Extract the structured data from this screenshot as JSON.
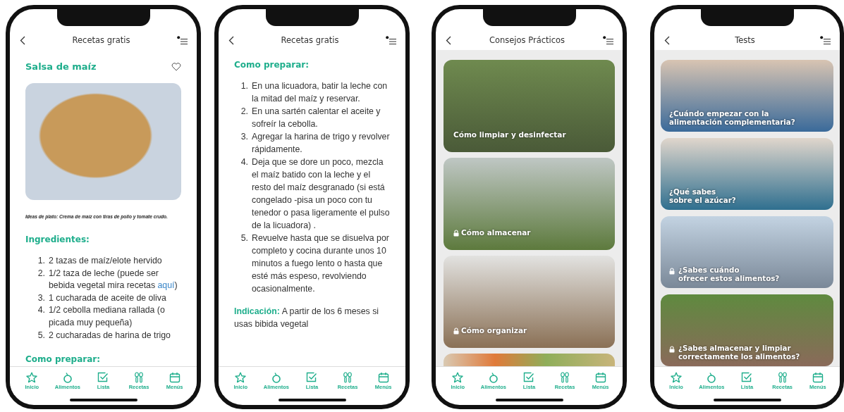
{
  "phones": [
    {
      "kind": "recipe",
      "header": {
        "title": "Recetas gratis"
      },
      "recipe_title": "Salsa de maíz",
      "caption": "Ideas de plato: Crema de maíz con tiras de pollo y tomate crudo.",
      "heading": "Ingredientes:",
      "items": [
        {
          "number": "1.",
          "text": "2 tazas de maíz/elote hervido"
        },
        {
          "number": "2.",
          "text": "1/2 taza de leche (puede ser bebida vegetal mira recetas ",
          "link": "aquí",
          "after": ")"
        },
        {
          "number": "3.",
          "text": "1 cucharada de aceite de oliva"
        },
        {
          "number": "4.",
          "text": "1/2 cebolla mediana rallada (o picada muy pequeña)"
        },
        {
          "number": "5.",
          "text": "2 cucharadas de harina de trigo"
        }
      ],
      "next_heading": "Como preparar:",
      "nav": [
        {
          "label": "Inicio",
          "kind": "star"
        },
        {
          "label": "Alimentos",
          "kind": "fruit"
        },
        {
          "label": "Lista",
          "kind": "check"
        },
        {
          "label": "Recetas",
          "kind": "utensils"
        },
        {
          "label": "Menús",
          "kind": "calendar"
        }
      ]
    },
    {
      "kind": "steps",
      "header": {
        "title": "Recetas gratis"
      },
      "heading": "Como preparar:",
      "items": [
        {
          "number": "1.",
          "text": "En una licuadora, batir la leche con la mitad del maíz y reservar."
        },
        {
          "number": "2.",
          "text": "En una sartén calentar el aceite y sofreír la cebolla."
        },
        {
          "number": "3.",
          "text": "Agregar la harina de trigo y revolver rápidamente."
        },
        {
          "number": "4.",
          "text": "Deja que se dore un poco, mezcla el maíz batido con la leche y el resto del maíz desgranado (si está congelado -pisa un poco con tu tenedor o pasa ligeramente el pulso de la licuadora) ."
        },
        {
          "number": "5.",
          "text": "Revuelve hasta que se disuelva por completo y cocina durante unos 10 minutos a fuego lento o hasta que esté más espeso, revolviendo ocasionalmente."
        }
      ],
      "note": "**Indicación:** A partir de los 6 meses si usas bibida vegetal",
      "nav": [
        {
          "label": "Inicio",
          "kind": "star"
        },
        {
          "label": "Alimentos",
          "kind": "fruit"
        },
        {
          "label": "Lista",
          "kind": "check"
        },
        {
          "label": "Recetas",
          "kind": "utensils"
        },
        {
          "label": "Menús",
          "kind": "calendar"
        }
      ]
    },
    {
      "kind": "tips",
      "header": {
        "title": "Consejos Prácticos"
      },
      "cards": [
        {
          "label": "Cómo limpiar y desinfectar",
          "locked": false
        },
        {
          "label": "Cómo almacenar",
          "locked": true
        },
        {
          "label": "Cómo organizar",
          "locked": true
        }
      ],
      "nav": [
        {
          "label": "Inicio",
          "kind": "star"
        },
        {
          "label": "Alimentos",
          "kind": "fruit"
        },
        {
          "label": "Lista",
          "kind": "check"
        },
        {
          "label": "Recetas",
          "kind": "utensils"
        },
        {
          "label": "Menús",
          "kind": "calendar"
        }
      ]
    },
    {
      "kind": "tests",
      "header": {
        "title": "Tests"
      },
      "cards": [
        {
          "label": "¿Cuándo empezar con la\nalimentación complementaria?",
          "locked": false
        },
        {
          "label": "¿Qué sabes\nsobre el azúcar?",
          "locked": false
        },
        {
          "label": "¿Sabes cuándo\nofrecer estos alimentos?",
          "locked": true
        },
        {
          "label": "¿Sabes almacenar y limpiar\ncorrectamente los alimentos?",
          "locked": true
        }
      ],
      "nav": [
        {
          "label": "Inicio",
          "kind": "star"
        },
        {
          "label": "Alimentos",
          "kind": "fruit"
        },
        {
          "label": "Lista",
          "kind": "check"
        },
        {
          "label": "Recetas",
          "kind": "utensils"
        },
        {
          "label": "Menús",
          "kind": "calendar"
        }
      ]
    }
  ]
}
